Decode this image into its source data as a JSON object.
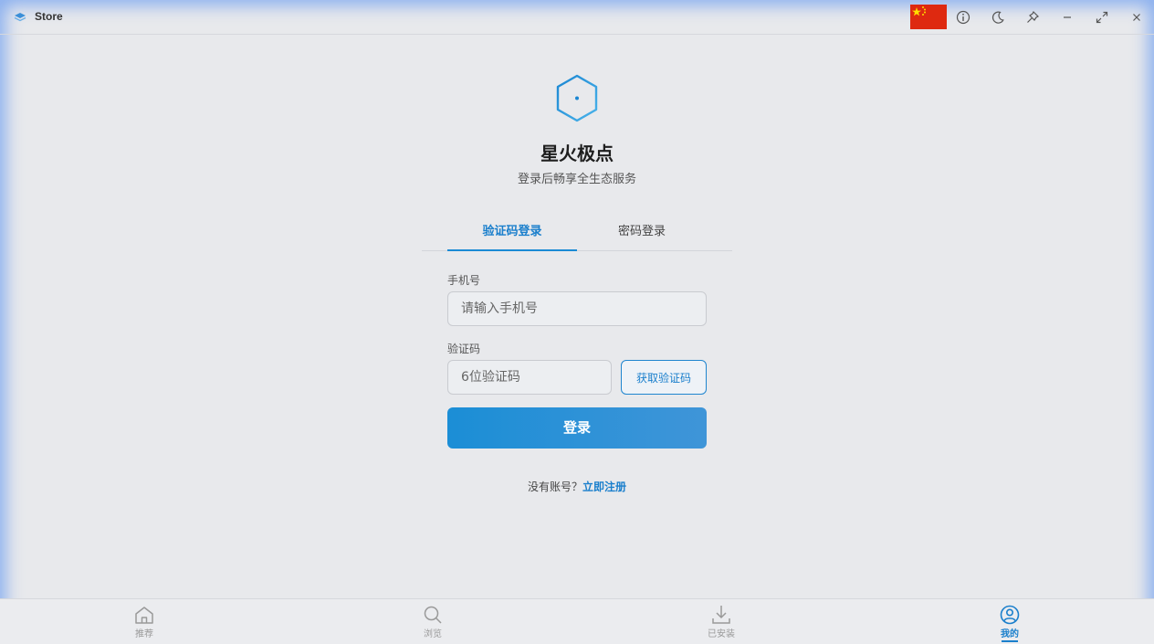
{
  "window": {
    "title": "Store"
  },
  "header": {
    "brand": "星火极点",
    "subtitle": "登录后畅享全生态服务"
  },
  "tabs": [
    {
      "label": "验证码登录",
      "active": true
    },
    {
      "label": "密码登录",
      "active": false
    }
  ],
  "form": {
    "phone_label": "手机号",
    "phone_placeholder": "请输入手机号",
    "phone_value": "",
    "code_label": "验证码",
    "code_placeholder": "6位验证码",
    "code_value": "",
    "get_code_label": "获取验证码",
    "login_label": "登录"
  },
  "register": {
    "prompt": "没有账号？",
    "link": "立即注册"
  },
  "bottom_nav": [
    {
      "label": "推荐",
      "icon": "home-icon",
      "active": false
    },
    {
      "label": "浏览",
      "icon": "search-icon",
      "active": false
    },
    {
      "label": "已安装",
      "icon": "download-icon",
      "active": false
    },
    {
      "label": "我的",
      "icon": "user-icon",
      "active": true
    }
  ],
  "colors": {
    "accent": "#1a8ad4",
    "background": "#e8e9ec",
    "flag_red": "#de2910",
    "flag_star": "#ffde00"
  },
  "titlebar_icons": [
    "china-flag-icon",
    "info-icon",
    "moon-icon",
    "pin-icon",
    "minimize-icon",
    "maximize-icon",
    "close-icon"
  ]
}
